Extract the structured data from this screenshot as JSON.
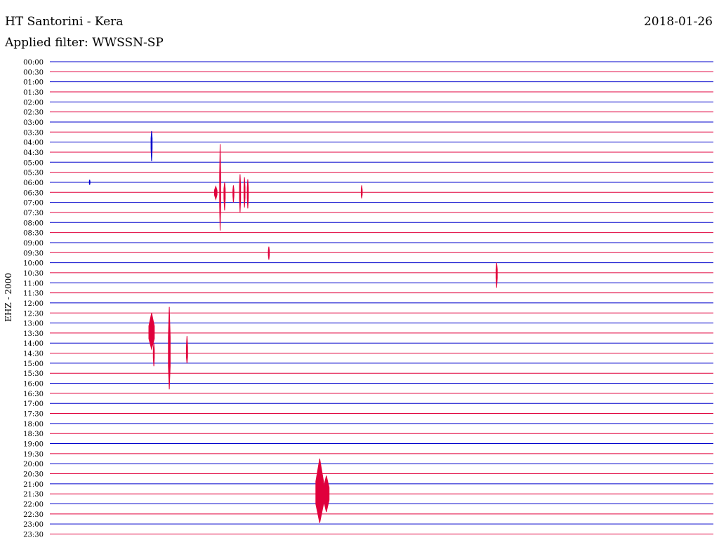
{
  "chart_data": {
    "type": "line",
    "title": "HT Santorini - Kera",
    "date": "2018-01-26",
    "subtitle": "Applied filter: WWSSN-SP",
    "ylabel": "EHZ - 2000",
    "row_labels": [
      "00:00",
      "00:30",
      "01:00",
      "01:30",
      "02:00",
      "02:30",
      "03:00",
      "03:30",
      "04:00",
      "04:30",
      "05:00",
      "05:30",
      "06:00",
      "06:30",
      "07:00",
      "07:30",
      "08:00",
      "08:30",
      "09:00",
      "09:30",
      "10:00",
      "10:30",
      "11:00",
      "11:30",
      "12:00",
      "12:30",
      "13:00",
      "13:30",
      "14:00",
      "14:30",
      "15:00",
      "15:30",
      "16:00",
      "16:30",
      "17:00",
      "17:30",
      "18:00",
      "18:30",
      "19:00",
      "19:30",
      "20:00",
      "20:30",
      "21:00",
      "21:30",
      "22:00",
      "22:30",
      "23:00",
      "23:30"
    ],
    "row_colors": [
      "#0000cc",
      "#e0003c"
    ],
    "row_minutes": 30,
    "events": [
      {
        "row": 8,
        "minute": 4.6,
        "up": 1.1,
        "down": 1.9,
        "width": 0.05
      },
      {
        "row": 12,
        "minute": 1.8,
        "up": 0.25,
        "down": 0.25,
        "width": 0.03
      },
      {
        "row": 13,
        "minute": 7.5,
        "up": 0.6,
        "down": 0.7,
        "width": 0.12
      },
      {
        "row": 13,
        "minute": 7.7,
        "up": 4.8,
        "down": 3.8,
        "width": 0.05
      },
      {
        "row": 13,
        "minute": 7.9,
        "up": 1.0,
        "down": 1.8,
        "width": 0.06
      },
      {
        "row": 13,
        "minute": 8.3,
        "up": 0.7,
        "down": 1.0,
        "width": 0.05
      },
      {
        "row": 13,
        "minute": 8.6,
        "up": 1.8,
        "down": 2.0,
        "width": 0.05
      },
      {
        "row": 13,
        "minute": 8.8,
        "up": 1.5,
        "down": 1.5,
        "width": 0.05
      },
      {
        "row": 13,
        "minute": 8.95,
        "up": 1.3,
        "down": 1.6,
        "width": 0.05
      },
      {
        "row": 13,
        "minute": 14.1,
        "up": 0.7,
        "down": 0.6,
        "width": 0.05
      },
      {
        "row": 19,
        "minute": 9.9,
        "up": 0.6,
        "down": 0.7,
        "width": 0.05
      },
      {
        "row": 21,
        "minute": 20.2,
        "up": 1.0,
        "down": 1.5,
        "width": 0.06
      },
      {
        "row": 27,
        "minute": 4.6,
        "up": 2.0,
        "down": 1.6,
        "width": 0.25
      },
      {
        "row": 29,
        "minute": 4.7,
        "up": 1.0,
        "down": 1.3,
        "width": 0.05
      },
      {
        "row": 29,
        "minute": 5.4,
        "up": 4.6,
        "down": 3.6,
        "width": 0.08
      },
      {
        "row": 29,
        "minute": 6.2,
        "up": 1.7,
        "down": 1.0,
        "width": 0.06
      },
      {
        "row": 43,
        "minute": 12.2,
        "up": 3.5,
        "down": 2.9,
        "width": 0.35
      },
      {
        "row": 43,
        "minute": 12.5,
        "up": 1.8,
        "down": 1.8,
        "width": 0.25
      }
    ]
  }
}
